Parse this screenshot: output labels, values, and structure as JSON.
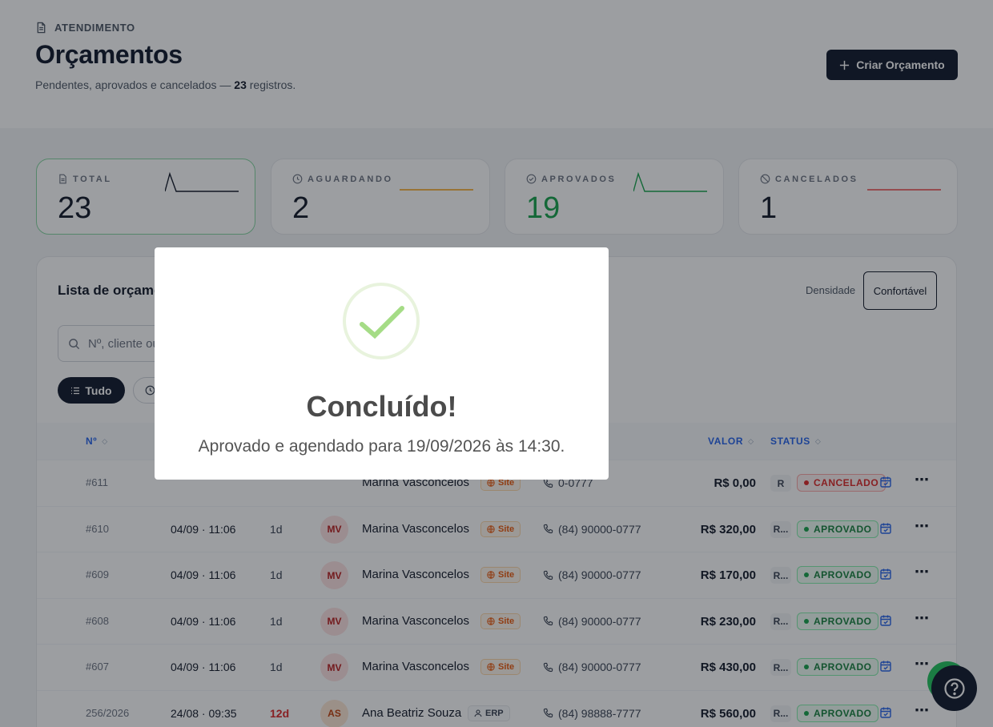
{
  "header": {
    "eyebrow": "ATENDIMENTO",
    "title": "Orçamentos",
    "subtitle_before": "Pendentes, aprovados e cancelados — ",
    "subtitle_count": "23",
    "subtitle_after": " registros.",
    "create_button": "Criar Orçamento"
  },
  "stats": [
    {
      "label": "TOTAL",
      "value": "23",
      "accent": "#111827"
    },
    {
      "label": "AGUARDANDO",
      "value": "2",
      "accent": "#f59e0b"
    },
    {
      "label": "APROVADOS",
      "value": "19",
      "accent": "#16a34a"
    },
    {
      "label": "CANCELADOS",
      "value": "1",
      "accent": "#ef4444"
    }
  ],
  "list": {
    "title": "Lista de orçame",
    "density_label": "Densidade",
    "density_value": "Confortável",
    "search_placeholder": "Nº, cliente ou",
    "filter_all": "Tudo",
    "columns": {
      "num": "Nº",
      "value": "VALOR",
      "status": "STATUS"
    },
    "rows": [
      {
        "num": "#611",
        "date": "",
        "age": "",
        "initials": "",
        "name": "Marina Vasconcelos",
        "source": "Site",
        "phone": "0-0777",
        "value": "R$ 0,00",
        "tag": "R",
        "status": "CANCELADO"
      },
      {
        "num": "#610",
        "date": "04/09 · 11:06",
        "age": "1d",
        "initials": "MV",
        "name": "Marina Vasconcelos",
        "source": "Site",
        "phone": "(84) 90000-0777",
        "value": "R$ 320,00",
        "tag": "R...",
        "status": "APROVADO"
      },
      {
        "num": "#609",
        "date": "04/09 · 11:06",
        "age": "1d",
        "initials": "MV",
        "name": "Marina Vasconcelos",
        "source": "Site",
        "phone": "(84) 90000-0777",
        "value": "R$ 170,00",
        "tag": "R...",
        "status": "APROVADO"
      },
      {
        "num": "#608",
        "date": "04/09 · 11:06",
        "age": "1d",
        "initials": "MV",
        "name": "Marina Vasconcelos",
        "source": "Site",
        "phone": "(84) 90000-0777",
        "value": "R$ 230,00",
        "tag": "R...",
        "status": "APROVADO"
      },
      {
        "num": "#607",
        "date": "04/09 · 11:06",
        "age": "1d",
        "initials": "MV",
        "name": "Marina Vasconcelos",
        "source": "Site",
        "phone": "(84) 90000-0777",
        "value": "R$ 430,00",
        "tag": "R...",
        "status": "APROVADO"
      },
      {
        "num": "256/2026",
        "date": "24/08 · 09:35",
        "age": "12d",
        "initials": "AS",
        "name": "Ana Beatriz Souza",
        "source": "ERP",
        "phone": "(84) 98888-7777",
        "value": "R$ 560,00",
        "tag": "R...",
        "status": "APROVADO"
      }
    ]
  },
  "modal": {
    "title": "Concluído!",
    "message": "Aprovado e agendado para 19/09/2026 às 14:30."
  },
  "icons": {
    "help": "help-circle-icon",
    "check": "check-icon"
  }
}
